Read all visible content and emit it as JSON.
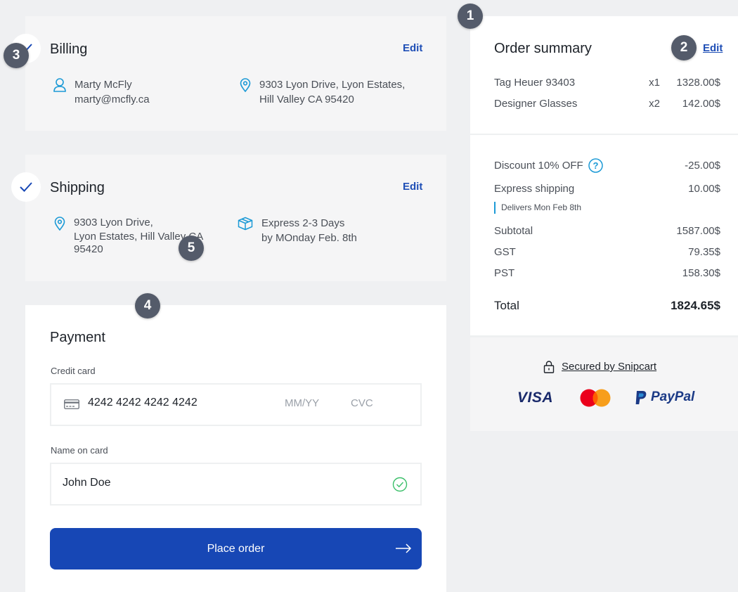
{
  "billing": {
    "title": "Billing",
    "edit_label": "Edit",
    "name": "Marty McFly",
    "email": "marty@mcfly.ca",
    "address_line1": "9303 Lyon Drive, Lyon Estates,",
    "address_line2": "Hill Valley CA 95420"
  },
  "shipping": {
    "title": "Shipping",
    "edit_label": "Edit",
    "address_line1": "9303 Lyon Drive,",
    "address_line2": "Lyon Estates, Hill Valley CA",
    "address_line3": "95420",
    "method_line1": "Express 2-3 Days",
    "method_line2": "by MOnday Feb. 8th"
  },
  "payment": {
    "title": "Payment",
    "card_label": "Credit card",
    "card_number": "4242 4242 4242 4242",
    "expiry_placeholder": "MM/YY",
    "cvc_placeholder": "CVC",
    "name_label": "Name on card",
    "name_value": "John Doe",
    "place_order_label": "Place order"
  },
  "summary": {
    "title": "Order summary",
    "edit_label": "Edit",
    "items": [
      {
        "name": "Tag Heuer 93403",
        "qty": "x1",
        "price": "1328.00$"
      },
      {
        "name": "Designer Glasses",
        "qty": "x2",
        "price": "142.00$"
      }
    ],
    "discount_label": "Discount 10% OFF",
    "discount_value": "-25.00$",
    "shipping_label": "Express shipping",
    "shipping_value": "10.00$",
    "delivers": "Delivers Mon Feb 8th",
    "subtotal_label": "Subtotal",
    "subtotal_value": "1587.00$",
    "gst_label": "GST",
    "gst_value": "79.35$",
    "pst_label": "PST",
    "pst_value": "158.30$",
    "total_label": "Total",
    "total_value": "1824.65$",
    "secured_label": "Secured by Snipcart",
    "visa_label": "VISA",
    "paypal_label": "PayPal"
  },
  "markers": [
    "1",
    "2",
    "3",
    "4",
    "5"
  ],
  "colors": {
    "accent": "#1747b5",
    "link": "#1f4fb6",
    "icon_blue": "#1c9ad6",
    "success": "#3bbf6a",
    "marker": "#545b6a"
  }
}
